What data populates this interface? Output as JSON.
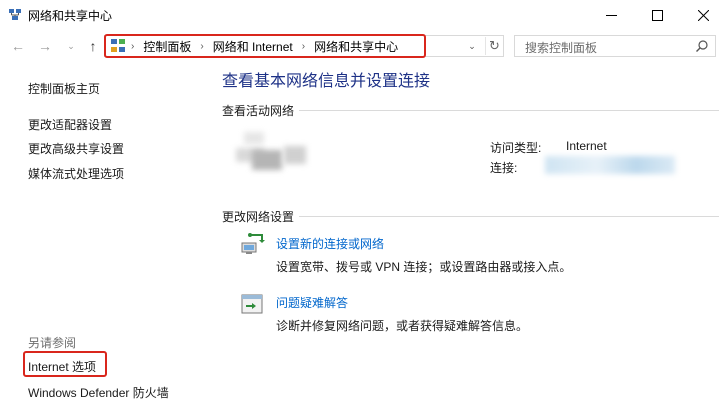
{
  "window": {
    "title": "网络和共享中心"
  },
  "address_bar": {
    "breadcrumbs": [
      "控制面板",
      "网络和 Internet",
      "网络和共享中心"
    ]
  },
  "search": {
    "placeholder": "搜索控制面板"
  },
  "left_pane": {
    "home_link": "控制面板主页",
    "links": [
      "更改适配器设置",
      "更改高级共享设置",
      "媒体流式处理选项"
    ],
    "see_also_label": "另请参阅",
    "see_also_links": [
      "Internet 选项",
      "Windows Defender 防火墙"
    ]
  },
  "main": {
    "title": "查看基本网络信息并设置连接",
    "active_network_header": "查看活动网络",
    "access_type_label": "访问类型:",
    "access_type_value": "Internet",
    "connection_label": "连接:",
    "change_settings_header": "更改网络设置",
    "tasks": [
      {
        "title": "设置新的连接或网络",
        "description": "设置宽带、拨号或 VPN 连接；或设置路由器或接入点。",
        "icon": "network-setup-icon"
      },
      {
        "title": "问题疑难解答",
        "description": "诊断并修复网络问题，或者获得疑难解答信息。",
        "icon": "troubleshoot-icon"
      }
    ]
  },
  "colors": {
    "highlight_border": "#d9261c",
    "link_blue": "#0066cc",
    "heading_blue": "#1e3287"
  }
}
